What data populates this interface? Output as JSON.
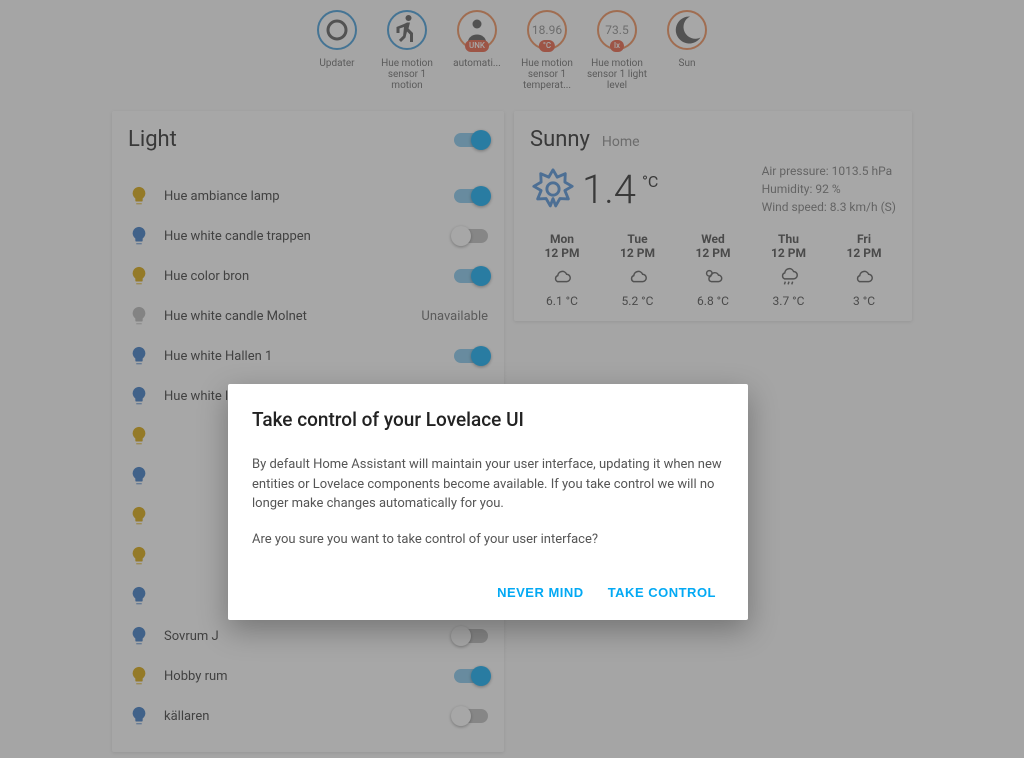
{
  "glance": [
    {
      "value": "",
      "icon": "circle",
      "label": "Updater",
      "badge": "",
      "color": "blue"
    },
    {
      "value": "",
      "icon": "walk",
      "label": "Hue motion sensor 1 motion",
      "badge": "",
      "color": "blue"
    },
    {
      "value": "",
      "icon": "person",
      "label": "automati...",
      "badge": "UNK",
      "color": "orange"
    },
    {
      "value": "18.96",
      "icon": "",
      "label": "Hue motion sensor 1 temperat...",
      "badge": "°C",
      "color": "orange"
    },
    {
      "value": "73.5",
      "icon": "",
      "label": "Hue motion sensor 1 light level",
      "badge": "lx",
      "color": "orange"
    },
    {
      "value": "",
      "icon": "moon",
      "label": "Sun",
      "badge": "",
      "color": "orange"
    }
  ],
  "light_card": {
    "title": "Light",
    "master_on": true,
    "unavailable_label": "Unavailable",
    "rows": [
      {
        "name": "Hue ambiance lamp",
        "bulb": "#d9a400",
        "state": "on"
      },
      {
        "name": "Hue white candle trappen",
        "bulb": "#3374c2",
        "state": "off"
      },
      {
        "name": "Hue color bron",
        "bulb": "#d9a400",
        "state": "on"
      },
      {
        "name": "Hue white candle Molnet",
        "bulb": "#b7b7b7",
        "state": "unavailable"
      },
      {
        "name": "Hue white Hallen 1",
        "bulb": "#3374c2",
        "state": "on"
      },
      {
        "name": "Hue white lamp Sovrum J",
        "bulb": "#3374c2",
        "state": "off"
      },
      {
        "name": "",
        "bulb": "#d9a400",
        "state": "on"
      },
      {
        "name": "",
        "bulb": "#3374c2",
        "state": "off"
      },
      {
        "name": "",
        "bulb": "#d9a400",
        "state": "on"
      },
      {
        "name": "",
        "bulb": "#d9a400",
        "state": "off"
      },
      {
        "name": "",
        "bulb": "#3374c2",
        "state": "on"
      },
      {
        "name": "Sovrum J",
        "bulb": "#3374c2",
        "state": "off"
      },
      {
        "name": "Hobby rum",
        "bulb": "#d9a400",
        "state": "on"
      },
      {
        "name": "källaren",
        "bulb": "#3374c2",
        "state": "off"
      }
    ]
  },
  "weather": {
    "condition": "Sunny",
    "location": "Home",
    "temp": "1.4",
    "unit": "°C",
    "pressure_label": "Air pressure: 1013.5 hPa",
    "humidity_label": "Humidity: 92 %",
    "wind_label": "Wind speed: 8.3 km/h (S)",
    "days": [
      {
        "day": "Mon",
        "time": "12 PM",
        "icon": "cloudy",
        "temp": "6.1 °C"
      },
      {
        "day": "Tue",
        "time": "12 PM",
        "icon": "cloudy",
        "temp": "5.2 °C"
      },
      {
        "day": "Wed",
        "time": "12 PM",
        "icon": "partly",
        "temp": "6.8 °C"
      },
      {
        "day": "Thu",
        "time": "12 PM",
        "icon": "rain",
        "temp": "3.7 °C"
      },
      {
        "day": "Fri",
        "time": "12 PM",
        "icon": "cloudy",
        "temp": "3 °C"
      }
    ]
  },
  "dialog": {
    "title": "Take control of your Lovelace UI",
    "para1": "By default Home Assistant will maintain your user interface, updating it when new entities or Lovelace components become available. If you take control we will no longer make changes automatically for you.",
    "para2": "Are you sure you want to take control of your user interface?",
    "cancel": "Never mind",
    "confirm": "Take control"
  }
}
